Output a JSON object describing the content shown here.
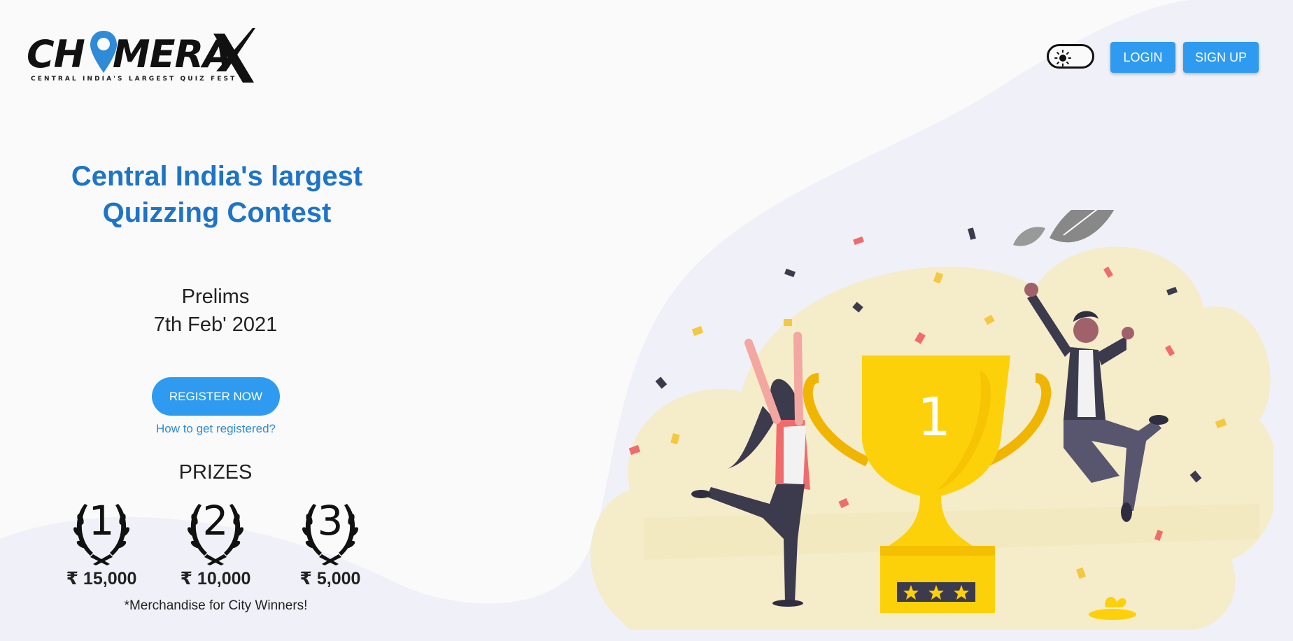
{
  "header": {
    "logo_text": "CHIMERAX",
    "logo_tagline": "CENTRAL INDIA'S LARGEST QUIZ FEST",
    "theme_toggle_icon": "sun-icon",
    "login_label": "LOGIN",
    "signup_label": "SIGN UP"
  },
  "hero": {
    "headline_line1": "Central India's largest",
    "headline_line2": "Quizzing Contest",
    "event_name": "Prelims",
    "event_date": "7th Feb' 2021",
    "register_label": "REGISTER NOW",
    "how_link": "How to get registered?"
  },
  "prizes": {
    "title": "PRIZES",
    "items": [
      {
        "rank": "1",
        "amount": "₹ 15,000"
      },
      {
        "rank": "2",
        "amount": "₹ 10,000"
      },
      {
        "rank": "3",
        "amount": "₹ 5,000"
      }
    ],
    "note": "*Merchandise for City Winners!"
  },
  "illustration": {
    "trophy_number": "1"
  },
  "colors": {
    "accent": "#2e9bf0",
    "headline": "#1e74c8",
    "trophy": "#fdd10a",
    "blob": "#f5ecc9"
  }
}
